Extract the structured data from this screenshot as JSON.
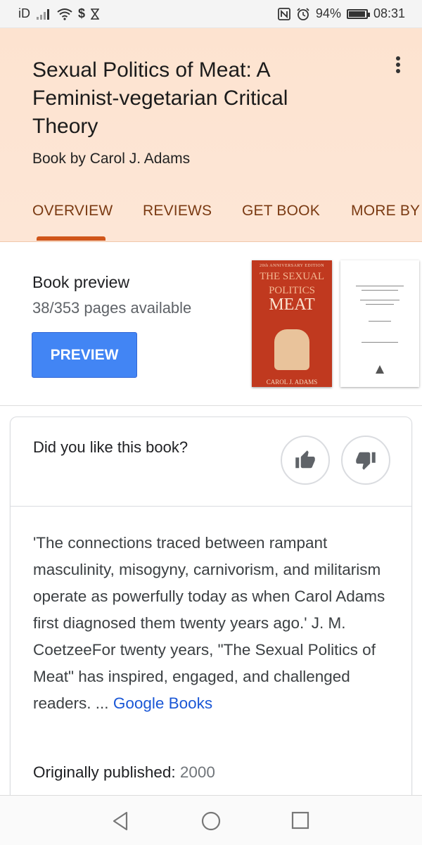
{
  "status_bar": {
    "carrier": "iD",
    "battery_percent": "94%",
    "battery_level": 0.94,
    "time": "08:31",
    "icons": [
      "signal-icon",
      "wifi-icon",
      "s-icon",
      "hourglass-icon",
      "nfc-icon",
      "alarm-icon",
      "battery-icon"
    ]
  },
  "header": {
    "title": "Sexual Politics of Meat: A Feminist-vegetarian Critical Theory",
    "subtitle": "Book by Carol J. Adams",
    "tabs": [
      {
        "label": "OVERVIEW",
        "active": true
      },
      {
        "label": "REVIEWS",
        "active": false
      },
      {
        "label": "GET BOOK",
        "active": false
      },
      {
        "label": "MORE BY",
        "active": false
      }
    ],
    "accent": "#d0561a"
  },
  "preview": {
    "title": "Book preview",
    "pages": "38/353 pages available",
    "button_label": "PREVIEW",
    "cover": {
      "edition": "20th ANNIVERSARY EDITION",
      "title_line1": "THE SEXUAL",
      "title_line2": "POLITICS",
      "title_line3": "OF",
      "title_line4": "MEAT",
      "author": "CAROL J. ADAMS"
    }
  },
  "rating": {
    "question": "Did you like this book?"
  },
  "description": {
    "text": "'The connections traced between rampant masculinity, misogyny, carnivorism, and militarism operate as powerfully today as when Carol Adams first diagnosed them twenty years ago.' J. M. CoetzeeFor twenty years, \"The Sexual Politics of Meat\" has inspired, engaged, and challenged readers. ...",
    "link_text": "Google Books"
  },
  "published": {
    "label": "Originally published:",
    "value": "2000"
  }
}
